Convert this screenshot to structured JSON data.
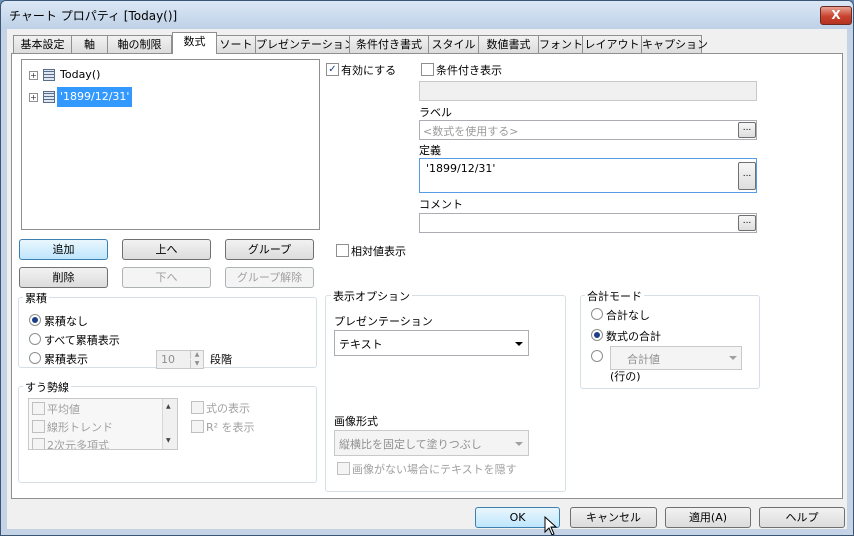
{
  "window": {
    "title": "チャート プロパティ [Today()]",
    "close_label": "X"
  },
  "tabs": [
    {
      "label": "基本設定"
    },
    {
      "label": "軸"
    },
    {
      "label": "軸の制限"
    },
    {
      "label": "数式"
    },
    {
      "label": "ソート"
    },
    {
      "label": "プレゼンテーション"
    },
    {
      "label": "条件付き書式"
    },
    {
      "label": "スタイル"
    },
    {
      "label": "数値書式"
    },
    {
      "label": "フォント"
    },
    {
      "label": "レイアウト"
    },
    {
      "label": "キャプション"
    }
  ],
  "active_tab": "数式",
  "tree": {
    "items": [
      {
        "label": "Today()"
      },
      {
        "label": "'1899/12/31'",
        "selected": true
      }
    ]
  },
  "expr_buttons": {
    "add": "追加",
    "up": "上へ",
    "group": "グループ",
    "delete": "削除",
    "down": "下へ",
    "ungroup": "グループ解除"
  },
  "accumulation": {
    "title": "累積",
    "options": [
      {
        "label": "累積なし"
      },
      {
        "label": "すべて累積表示"
      },
      {
        "label": "累積表示"
      }
    ],
    "selected": "累積なし",
    "steps_value": "10",
    "steps_label": "段階"
  },
  "trendlines": {
    "title": "すう勢線",
    "items": [
      {
        "label": "平均値"
      },
      {
        "label": "線形トレンド"
      },
      {
        "label": "2次元多項式"
      }
    ],
    "show_equation": "式の表示",
    "show_r2": "R² を表示"
  },
  "enable": {
    "label": "有効にする",
    "checked": true
  },
  "conditional_show": {
    "label": "条件付き表示",
    "checked": false
  },
  "label_field": {
    "label": "ラベル",
    "placeholder": "<数式を使用する>",
    "dots": "..."
  },
  "definition": {
    "label": "定義",
    "value": "'1899/12/31'",
    "dots": "..."
  },
  "comment": {
    "label": "コメント",
    "value": "",
    "dots": "..."
  },
  "relative": {
    "label": "相対値表示",
    "checked": false
  },
  "display_options": {
    "title": "表示オプション",
    "presentation_label": "プレゼンテーション",
    "presentation_value": "テキスト",
    "image_format_label": "画像形式",
    "image_format_value": "縦横比を固定して塗りつぶし",
    "hide_text_label": "画像がない場合にテキストを隠す"
  },
  "total_mode": {
    "title": "合計モード",
    "options": [
      {
        "label": "合計なし"
      },
      {
        "label": "数式の合計"
      }
    ],
    "selected": "数式の合計",
    "func_value": "合計値",
    "row_label": "(行の)"
  },
  "footer": {
    "ok": "OK",
    "cancel": "キャンセル",
    "apply": "適用(A)",
    "help": "ヘルプ"
  }
}
